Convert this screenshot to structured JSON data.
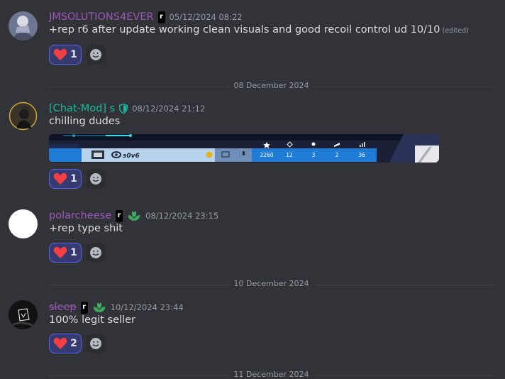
{
  "messages": [
    {
      "username": "JMSOLUTIONS4EVER",
      "username_color": "#9b59b6",
      "badge": "r",
      "timestamp": "05/12/2024 08:22",
      "text": "+rep r6 after update working clean visuals and good recoil control ud 10/10",
      "edited_label": "(edited)",
      "reaction_count": "1"
    },
    {
      "username": "[Chat-Mod] s",
      "username_color": "#1abc9c",
      "timestamp": "08/12/2024 21:12",
      "text": "chilling dudes",
      "reaction_count": "1",
      "embed": {
        "player_name": "s0v6",
        "stats": [
          "2260",
          "12",
          "3",
          "2",
          "36"
        ]
      }
    },
    {
      "username": "polarcheese",
      "username_color": "#9b59b6",
      "badge": "r",
      "timestamp": "08/12/2024 23:15",
      "text": "+rep type shit",
      "reaction_count": "1"
    },
    {
      "username": "sleep",
      "username_color": "#9b59b6",
      "badge": "r",
      "timestamp": "10/12/2024 23:44",
      "text": "100% legit seller",
      "reaction_count": "2"
    }
  ],
  "dividers": [
    "08 December 2024",
    "10 December 2024",
    "11 December 2024"
  ],
  "colors": {
    "background": "#313338",
    "reaction_border": "#5865f2",
    "heart": "#f23f43",
    "leaf": "#3ba55c"
  }
}
